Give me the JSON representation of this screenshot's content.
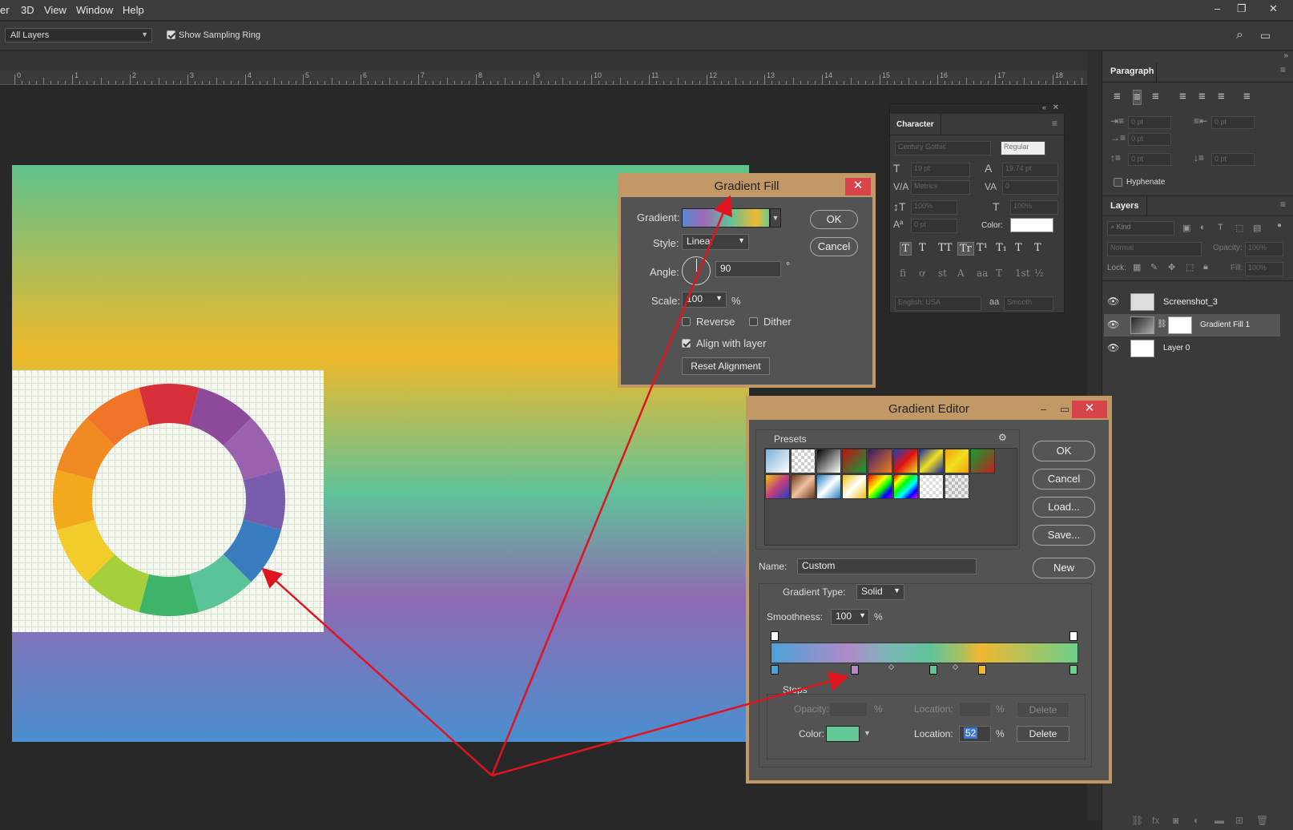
{
  "menubar": {
    "items": [
      "er",
      "3D",
      "View",
      "Window",
      "Help"
    ],
    "window_buttons": [
      "–",
      "❐",
      "✕"
    ]
  },
  "options": {
    "sample_select": "All Layers",
    "show_sampling_ring": "Show Sampling Ring"
  },
  "ruler": {
    "ticks": [
      "0",
      "1",
      "2",
      "3",
      "4",
      "5",
      "6",
      "7",
      "8",
      "9",
      "10",
      "11",
      "12",
      "13",
      "14",
      "15",
      "16",
      "17",
      "18"
    ]
  },
  "paragraph_panel": {
    "title": "Paragraph",
    "indent_values": [
      "0 pt",
      "0 pt",
      "0 pt",
      "0 pt",
      "0 pt"
    ],
    "hyphenate": "Hyphenate"
  },
  "layers_panel": {
    "title": "Layers",
    "kind_placeholder": "Kind",
    "blend_mode": "Normal",
    "opacity_label": "Opacity:",
    "opacity_value": "100%",
    "lock_label": "Lock:",
    "fill_label": "Fill:",
    "fill_value": "100%",
    "layers": [
      {
        "name": "Screenshot_3"
      },
      {
        "name": "Gradient Fill 1"
      },
      {
        "name": "Layer 0"
      }
    ]
  },
  "character_panel": {
    "title": "Character",
    "font_family": "Century Gothic",
    "font_style": "Regular",
    "font_size": "19 pt",
    "leading": "19.74 pt",
    "kerning": "Metrics",
    "tracking": "0",
    "vertical_scale": "100%",
    "horizontal_scale": "100%",
    "baseline_shift": "0 pt",
    "color_label": "Color:",
    "language": "English: USA",
    "antialias_prefix": "aa",
    "antialias": "Smooth",
    "style_buttons": [
      "T",
      "T",
      "TT",
      "Tr",
      "T¹",
      "T₁",
      "T",
      "T"
    ],
    "otype_buttons": [
      "fi",
      "ơ",
      "st",
      "A",
      "aa",
      "T",
      "1st",
      "½"
    ]
  },
  "gradient_fill": {
    "title": "Gradient Fill",
    "gradient_label": "Gradient:",
    "style_label": "Style:",
    "style_value": "Linear",
    "angle_label": "Angle:",
    "angle_value": "90",
    "angle_unit": "°",
    "scale_label": "Scale:",
    "scale_value": "100",
    "scale_unit": "%",
    "reverse": "Reverse",
    "dither": "Dither",
    "align_with_layer": "Align with layer",
    "reset_alignment": "Reset Alignment",
    "ok": "OK",
    "cancel": "Cancel"
  },
  "gradient_editor": {
    "title": "Gradient Editor",
    "presets_label": "Presets",
    "ok": "OK",
    "cancel": "Cancel",
    "load": "Load...",
    "save": "Save...",
    "name_label": "Name:",
    "name_value": "Custom",
    "new": "New",
    "gradient_type_label": "Gradient Type:",
    "gradient_type_value": "Solid",
    "smoothness_label": "Smoothness:",
    "smoothness_value": "100",
    "smoothness_unit": "%",
    "stops_label": "Stops",
    "opacity_label": "Opacity:",
    "opacity_unit": "%",
    "location_label": "Location:",
    "location_unit": "%",
    "delete": "Delete",
    "color_label": "Color:",
    "location_value": "52",
    "color_stop_colors": [
      "#4aa3d8",
      "#b08ac8",
      "#60c49a",
      "#f0b830",
      "#6ccf8a"
    ],
    "selected_color": "#64c896"
  },
  "colors": {
    "dialog_frame": "#c29866",
    "close_red": "#d7454b",
    "annotation_red": "#e0141e"
  }
}
